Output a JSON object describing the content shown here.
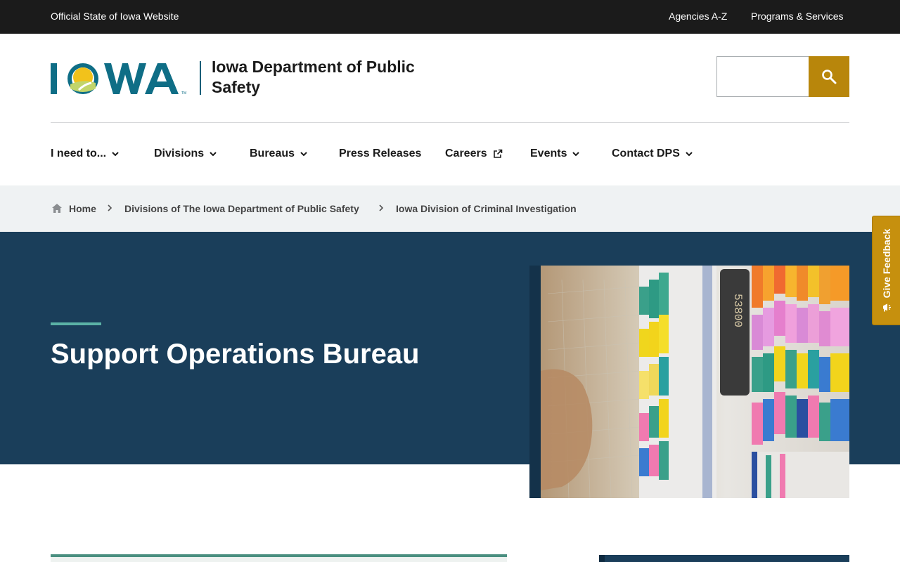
{
  "utility": {
    "official": "Official State of Iowa Website",
    "links": [
      "Agencies A-Z",
      "Programs & Services"
    ]
  },
  "header": {
    "logo_text": "IOWA",
    "agency_name": "Iowa Department of Public Safety",
    "search": {
      "placeholder": "",
      "value": "",
      "icon": "search-icon"
    }
  },
  "nav": {
    "items": [
      {
        "label": "I need to...",
        "icon": "chevron-down-icon"
      },
      {
        "label": "Divisions",
        "icon": "chevron-down-icon"
      },
      {
        "label": "Bureaus",
        "icon": "chevron-down-icon"
      },
      {
        "label": "Press Releases",
        "icon": ""
      },
      {
        "label": "Careers",
        "icon": "external-link-icon"
      },
      {
        "label": "Events",
        "icon": "chevron-down-icon"
      },
      {
        "label": "Contact DPS",
        "icon": "chevron-down-icon"
      }
    ]
  },
  "breadcrumb": {
    "items": [
      "Home",
      "Divisions of The Iowa Department of Public Safety",
      "Iowa Division of Criminal Investigation"
    ]
  },
  "hero": {
    "title": "Support Operations Bureau",
    "photo_label": "53800"
  },
  "feedback": {
    "label": "Give Feedback",
    "icon": "megaphone-icon"
  },
  "colors": {
    "utility_bg": "#1b1b1b",
    "brand_teal": "#0f5e78",
    "accent_gold": "#b8860b",
    "hero_bg": "#1a3e5a",
    "hero_accent": "#5bb2a6",
    "breadcrumb_bg": "#eff2f3"
  }
}
